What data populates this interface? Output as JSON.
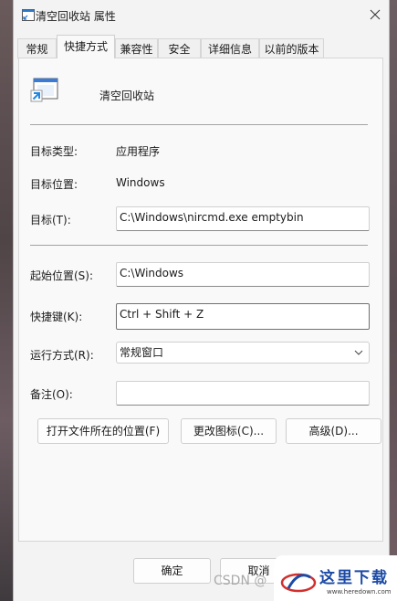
{
  "window": {
    "title": "清空回收站 属性",
    "tabs": [
      "常规",
      "快捷方式",
      "兼容性",
      "安全",
      "详细信息",
      "以前的版本"
    ],
    "active_tab_index": 1
  },
  "shortcut": {
    "name": "清空回收站",
    "target_type_label": "目标类型:",
    "target_type_value": "应用程序",
    "target_location_label": "目标位置:",
    "target_location_value": "Windows",
    "target_label": "目标(T):",
    "target_value": "C:\\Windows\\nircmd.exe emptybin",
    "start_in_label": "起始位置(S):",
    "start_in_value": "C:\\Windows",
    "hotkey_label": "快捷键(K):",
    "hotkey_value": "Ctrl + Shift + Z",
    "run_label": "运行方式(R):",
    "run_value": "常规窗口",
    "comment_label": "备注(O):",
    "comment_value": "",
    "open_location_button": "打开文件所在的位置(F)",
    "change_icon_button": "更改图标(C)...",
    "advanced_button": "高级(D)..."
  },
  "footer": {
    "ok_button": "确定",
    "cancel_button": "取消"
  },
  "overlay": {
    "watermark": "CSDN @",
    "logo_text": "这里下载",
    "logo_url": "www.heredown.com"
  },
  "colors": {
    "accent": "#1c4aa5",
    "icon_blue": "#1e88e5"
  }
}
